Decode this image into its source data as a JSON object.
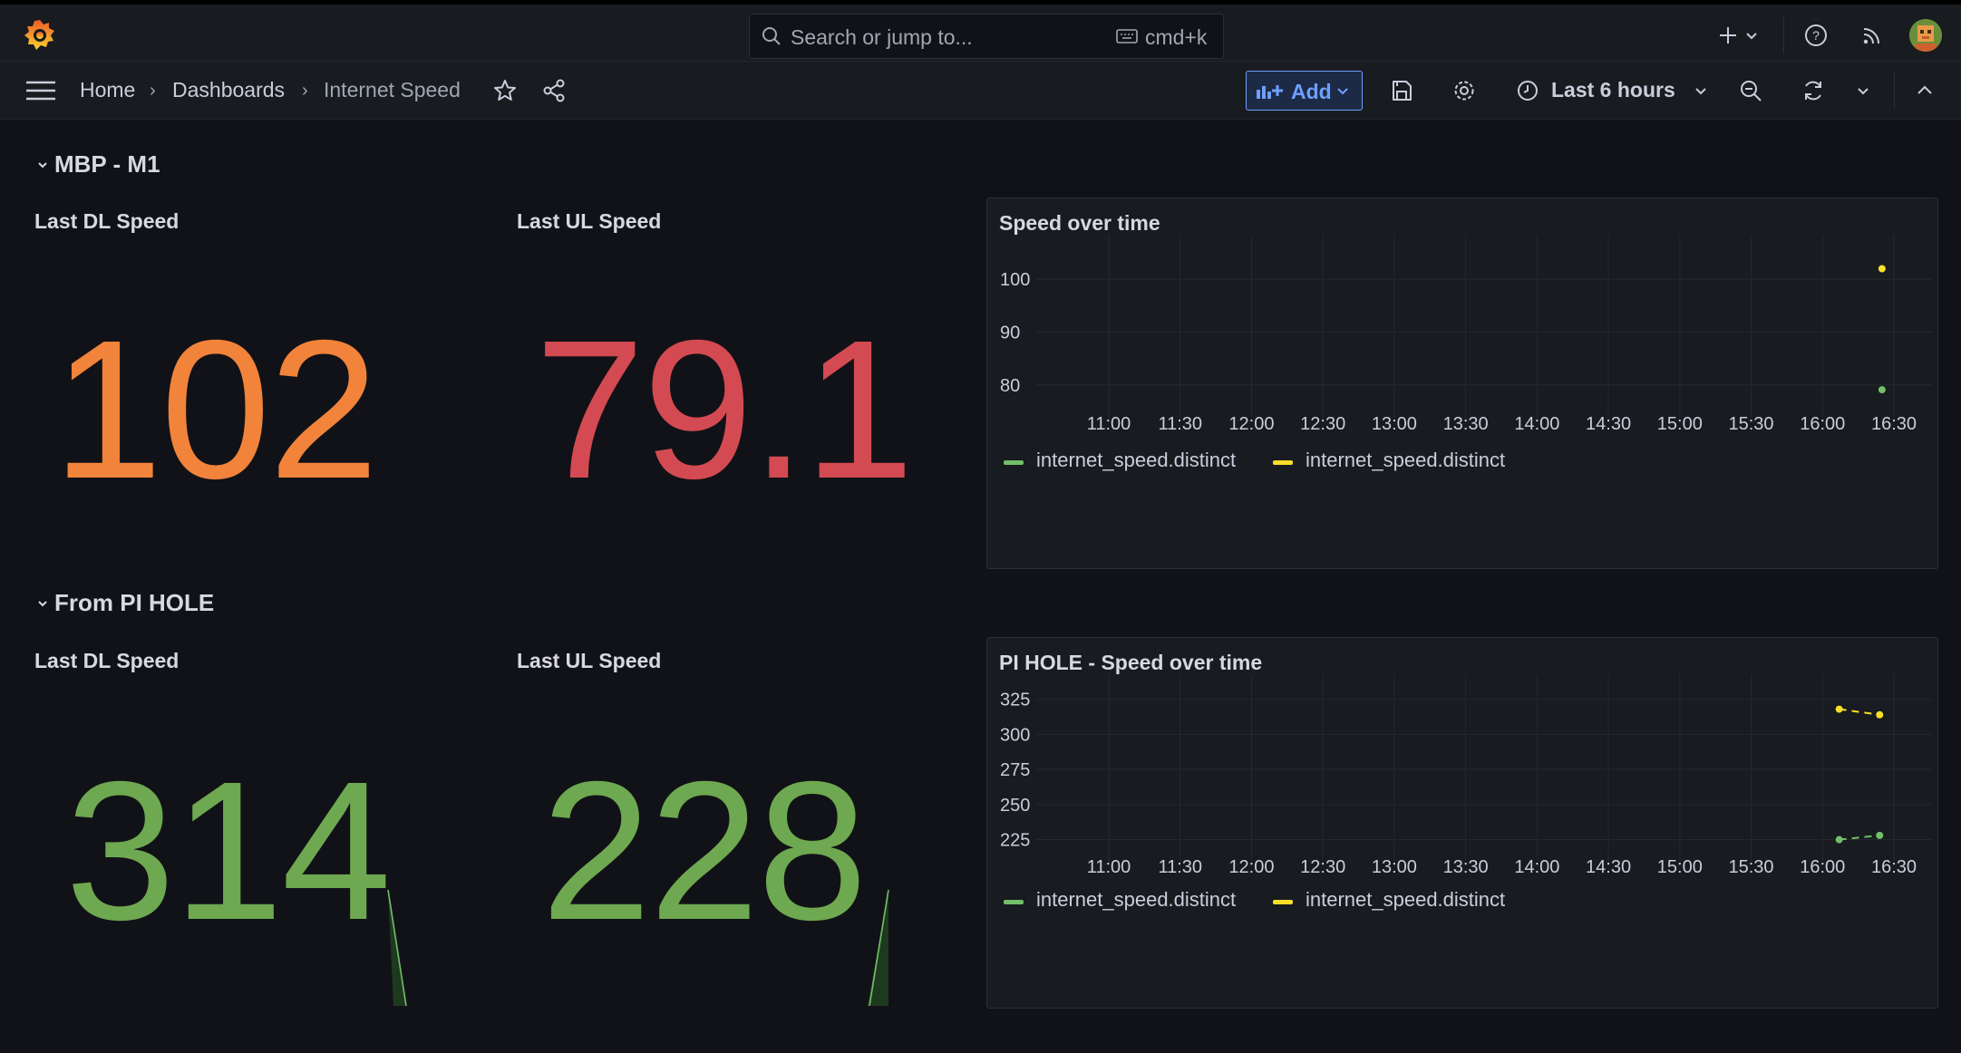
{
  "topbar": {
    "search_placeholder": "Search or jump to...",
    "search_shortcut": "cmd+k",
    "icons": [
      "grafana-logo",
      "search-icon",
      "keyboard-icon",
      "plus-icon",
      "chevron-down-icon",
      "help-icon",
      "news-icon",
      "avatar"
    ]
  },
  "breadcrumb": {
    "items": [
      "Home",
      "Dashboards",
      "Internet Speed"
    ],
    "separator": "›"
  },
  "toolbar": {
    "add_label": "Add",
    "time_range": "Last 6 hours"
  },
  "colors": {
    "background": "#111217",
    "panel": "#181b1f",
    "orange": "#f2833a",
    "red": "#d44a52",
    "green": "#6ea850",
    "series_green": "#73bf69",
    "series_yellow": "#fade2a",
    "accent": "#6e9fff"
  },
  "rows": [
    {
      "title": "MBP - M1",
      "stats": [
        {
          "title": "Last DL Speed",
          "value": "102",
          "color": "#f2833a"
        },
        {
          "title": "Last UL Speed",
          "value": "79.1",
          "color": "#d44a52"
        }
      ],
      "chart_title": "Speed over time"
    },
    {
      "title": "From PI HOLE",
      "stats": [
        {
          "title": "Last DL Speed",
          "value": "314",
          "color": "#6ea850"
        },
        {
          "title": "Last UL Speed",
          "value": "228",
          "color": "#6ea850"
        }
      ],
      "chart_title": "PI HOLE - Speed over time"
    }
  ],
  "chart_data": [
    {
      "type": "scatter",
      "title": "Speed over time",
      "x_ticks": [
        "11:00",
        "11:30",
        "12:00",
        "12:30",
        "13:00",
        "13:30",
        "14:00",
        "14:30",
        "15:00",
        "15:30",
        "16:00",
        "16:30"
      ],
      "y_ticks": [
        100,
        90,
        80
      ],
      "ylim": [
        75,
        105
      ],
      "series": [
        {
          "name": "internet_speed.distinct",
          "color": "#73bf69",
          "points": [
            {
              "x": "16:25",
              "y": 79.1
            }
          ]
        },
        {
          "name": "internet_speed.distinct",
          "color": "#fade2a",
          "points": [
            {
              "x": "16:25",
              "y": 102
            }
          ]
        }
      ]
    },
    {
      "type": "line",
      "title": "PI HOLE - Speed over time",
      "x_ticks": [
        "11:00",
        "11:30",
        "12:00",
        "12:30",
        "13:00",
        "13:30",
        "14:00",
        "14:30",
        "15:00",
        "15:30",
        "16:00",
        "16:30"
      ],
      "y_ticks": [
        325,
        300,
        275,
        250,
        225
      ],
      "ylim": [
        215,
        330
      ],
      "series": [
        {
          "name": "internet_speed.distinct",
          "color": "#73bf69",
          "points": [
            {
              "x": "16:07",
              "y": 225
            },
            {
              "x": "16:24",
              "y": 228
            }
          ]
        },
        {
          "name": "internet_speed.distinct",
          "color": "#fade2a",
          "points": [
            {
              "x": "16:07",
              "y": 318
            },
            {
              "x": "16:24",
              "y": 314
            }
          ]
        }
      ]
    }
  ]
}
